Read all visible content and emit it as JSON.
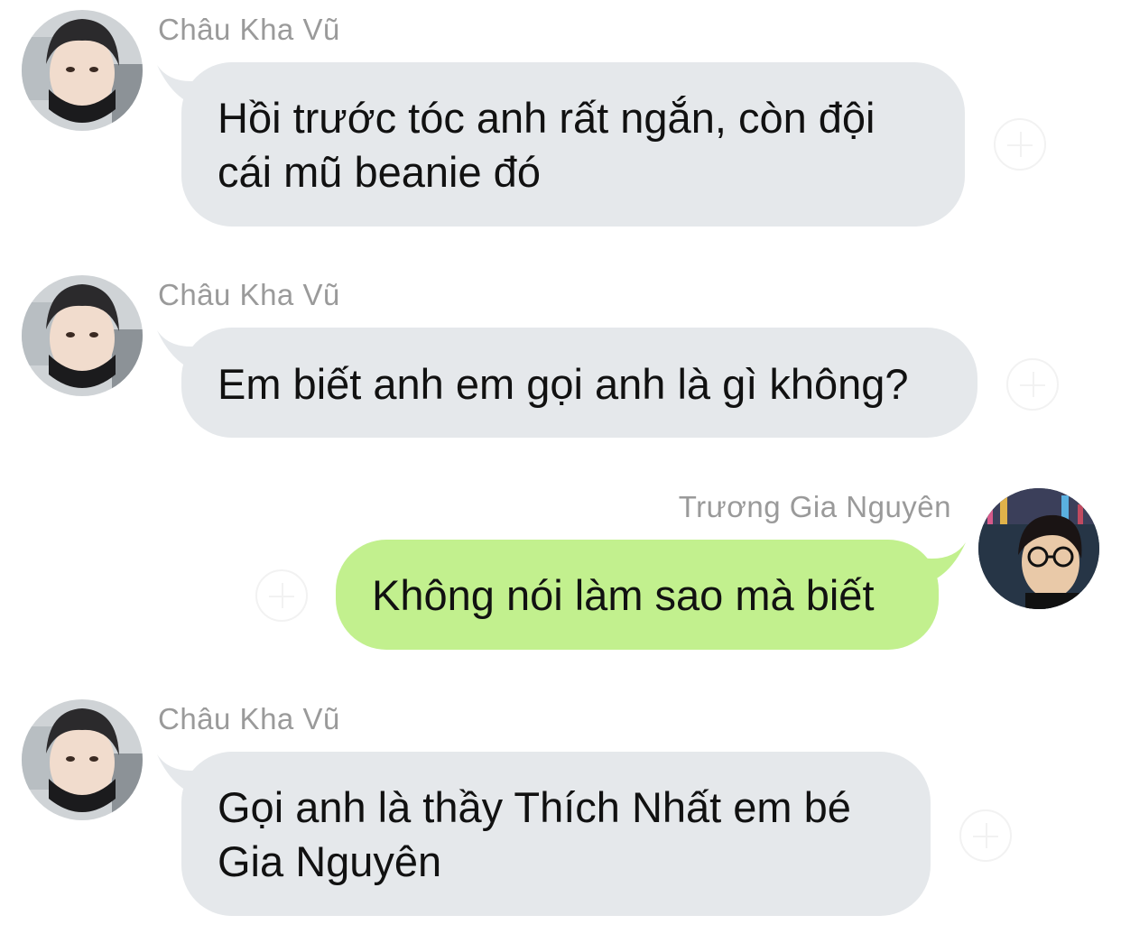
{
  "conversation": {
    "messages": [
      {
        "sender": "Châu Kha Vũ",
        "direction": "incoming",
        "lines": [
          "Hồi trước tóc anh rất ngắn, còn đội",
          "cái mũ beanie đó"
        ]
      },
      {
        "sender": "Châu Kha Vũ",
        "direction": "incoming",
        "lines": [
          "Em biết anh em gọi anh là gì không?"
        ]
      },
      {
        "sender": "Trương Gia Nguyên",
        "direction": "outgoing",
        "lines": [
          "Không nói làm sao mà biết"
        ]
      },
      {
        "sender": "Châu Kha Vũ",
        "direction": "incoming",
        "lines": [
          "Gọi anh là thầy Thích Nhất em bé",
          "Gia Nguyên"
        ]
      }
    ]
  },
  "colors": {
    "incoming_bubble": "#e5e8eb",
    "outgoing_bubble": "#c2f08e",
    "sender_name": "#9a9a9a",
    "background": "#ffffff"
  },
  "icons": {
    "reaction": "add-reaction-icon",
    "avatar_a": "user-avatar",
    "avatar_b": "user-avatar"
  }
}
